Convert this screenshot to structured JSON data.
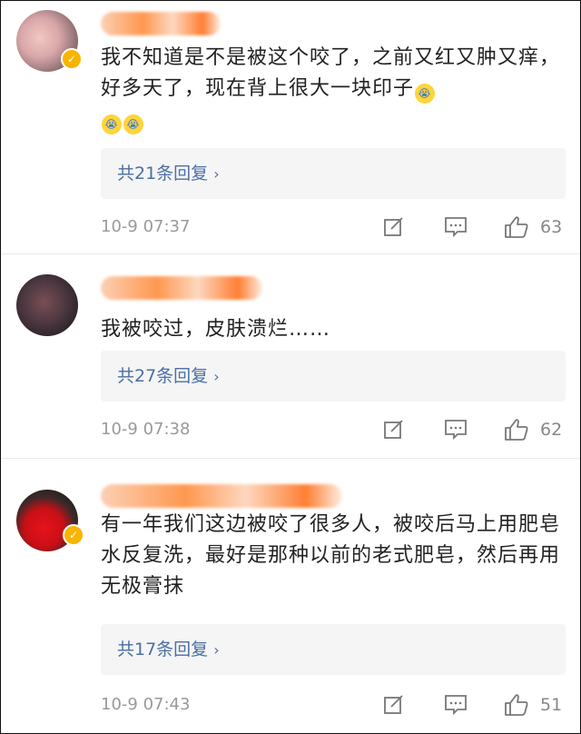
{
  "comments": [
    {
      "text": "我不知道是不是被这个咬了，之前又红又肿又痒，好多天了，现在背上很大一块印子",
      "emoji": [
        "😭",
        "😭",
        "😭"
      ],
      "replies": "共21条回复",
      "time": "10-9 07:37",
      "likes": "63",
      "verified": true
    },
    {
      "text": "我被咬过，皮肤溃烂……",
      "replies": "共27条回复",
      "time": "10-9 07:38",
      "likes": "62",
      "verified": false
    },
    {
      "text": "有一年我们这边被咬了很多人，被咬后马上用肥皂水反复洗，最好是那种以前的老式肥皂，然后再用无极膏抹",
      "replies": "共17条回复",
      "time": "10-9 07:43",
      "likes": "51",
      "verified": true
    }
  ],
  "ui": {
    "chevron": "›",
    "icons": {
      "edit": "edit-icon",
      "reply": "comment-icon",
      "like": "thumbs-up-icon",
      "verified": "verified-badge-icon"
    },
    "colors": {
      "link": "#4a6fa5",
      "meta": "#999999",
      "reply_bg": "#f5f5f5",
      "verified": "#f7b500"
    }
  }
}
